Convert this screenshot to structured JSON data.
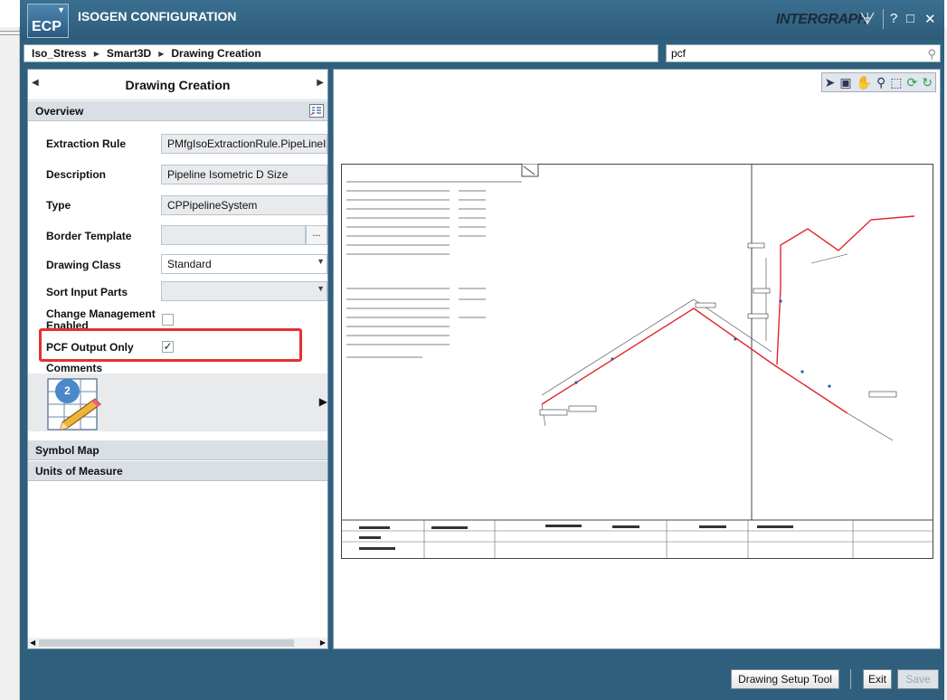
{
  "app": {
    "title": "ISOGEN CONFIGURATION",
    "logo": "ECP",
    "brand": "INTERGRAPH"
  },
  "window_controls": {
    "help": "?",
    "maximize": "□",
    "close": "✕"
  },
  "breadcrumb": [
    "Iso_Stress",
    "Smart3D",
    "Drawing Creation"
  ],
  "search": {
    "value": "pcf"
  },
  "panel": {
    "title": "Drawing Creation",
    "sections": {
      "overview": "Overview",
      "symbol_map": "Symbol Map",
      "units": "Units of Measure"
    },
    "properties": {
      "extraction_rule": {
        "label": "Extraction Rule",
        "value": "PMfgIsoExtractionRule.PipeLineIso"
      },
      "description": {
        "label": "Description",
        "value": "Pipeline Isometric D Size"
      },
      "type": {
        "label": "Type",
        "value": "CPPipelineSystem"
      },
      "border_template": {
        "label": "Border Template",
        "value": "",
        "button": "..."
      },
      "drawing_class": {
        "label": "Drawing Class",
        "value": "Standard"
      },
      "sort_input_parts": {
        "label": "Sort Input Parts",
        "value": ""
      },
      "change_management": {
        "label": "Change Management Enabled",
        "checked": false
      },
      "pcf_output_only": {
        "label": "PCF Output Only",
        "checked": true
      },
      "comments": {
        "label": "Comments",
        "badge": "2"
      }
    }
  },
  "viewer": {
    "tools": [
      "pointer-icon",
      "fit-icon",
      "pan-icon",
      "zoom-icon",
      "zoom-window-icon",
      "refresh-icon",
      "rotate-icon"
    ]
  },
  "footer": {
    "setup_tool": "Drawing Setup Tool",
    "exit": "Exit",
    "save": "Save"
  },
  "colors": {
    "frame": "#2f5f7c",
    "highlight": "#e53030",
    "pipe": "#e0262b"
  }
}
